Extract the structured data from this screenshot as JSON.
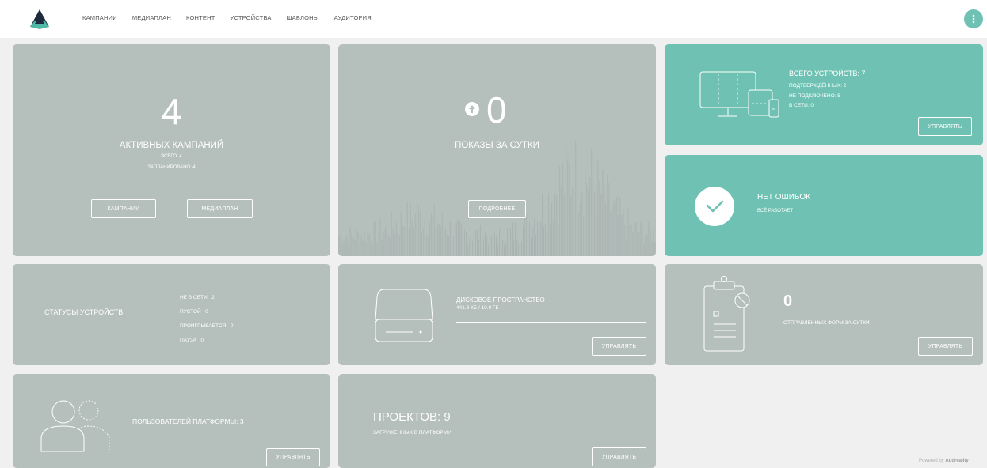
{
  "nav": {
    "items": [
      "КАМПАНИИ",
      "МЕДИАПЛАН",
      "КОНТЕНТ",
      "УСТРОЙСТВА",
      "ШАБЛОНЫ",
      "АУДИТОРИЯ"
    ]
  },
  "icons": {
    "logo": "brand-logo-icon",
    "menu": "kebab-menu-icon"
  },
  "colors": {
    "tile_gray": "#b5bfbc",
    "tile_teal": "#6fc2b3",
    "accent": "#6fc2b3",
    "background": "#f0f0f0"
  },
  "campaigns": {
    "count": "4",
    "title": "АКТИВНЫХ КАМПАНИЙ",
    "total": "ВСЕГО: 4",
    "scheduled": "ЗАПЛАНИРОВАНО: 4",
    "btn_campaigns": "КАМПАНИИ",
    "btn_mediaplan": "МЕДИАПЛАН"
  },
  "impressions": {
    "count": "0",
    "title": "ПОКАЗЫ ЗА СУТКИ",
    "btn_details": "ПОДРОБНЕЕ"
  },
  "devices": {
    "total": "ВСЕГО УСТРОЙСТВ: 7",
    "confirmed": "ПОДТВЕРЖДЁННЫХ: 2",
    "not_connected": "НЕ ПОДКЛЮЧЕНО: 5",
    "online": "В СЕТИ: 0",
    "btn_manage": "УПРАВЛЯТЬ"
  },
  "errors": {
    "title": "НЕТ ОШИБОК",
    "subtitle": "ВСЁ РАБОТАЕТ"
  },
  "statuses": {
    "title": "СТАТУСЫ УСТРОЙСТВ",
    "rows": [
      {
        "label": "НЕ В СЕТИ",
        "value": "2"
      },
      {
        "label": "ПУСТОЙ",
        "value": "0"
      },
      {
        "label": "ПРОИГРЫВАЕТСЯ",
        "value": "0"
      },
      {
        "label": "ПАУЗА",
        "value": "0"
      }
    ]
  },
  "disk": {
    "title": "ДИСКОВОЕ ПРОСТРАНСТВО",
    "usage": "441.3 КБ / 10.0 ГБ",
    "btn_manage": "УПРАВЛЯТЬ"
  },
  "forms": {
    "count": "0",
    "title": "ОТПРАВЛЕННЫХ ФОРМ ЗА СУТКИ",
    "btn_manage": "УПРАВЛЯТЬ"
  },
  "users": {
    "title": "ПОЛЬЗОВАТЕЛЕЙ ПЛАТФОРМЫ: 3",
    "btn_manage": "УПРАВЛЯТЬ"
  },
  "projects": {
    "title": "ПРОЕКТОВ: 9",
    "subtitle": "ЗАГРУЖЕННЫХ В ПЛАТФОРМУ",
    "btn_manage": "УПРАВЛЯТЬ"
  },
  "footer": {
    "powered_prefix": "Powered by",
    "powered_brand": "Addreality"
  }
}
